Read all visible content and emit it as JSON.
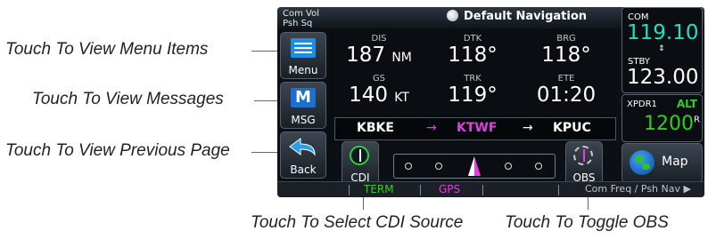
{
  "callouts": {
    "menu": "Touch To View Menu Items",
    "messages": "Touch To View Messages",
    "previous": "Touch To View Previous Page",
    "cdi_source": "Touch To Select CDI Source",
    "obs": "Touch To Toggle OBS"
  },
  "screen": {
    "top_left": [
      "Com Vol",
      "Psh Sq"
    ],
    "title": "Default Navigation",
    "buttons": {
      "menu": "Menu",
      "msg": "MSG",
      "back": "Back",
      "cdi": "CDI",
      "obs": "OBS",
      "map": "Map"
    },
    "fields": {
      "dis": {
        "label": "DIS",
        "value": "187",
        "unit": "NM"
      },
      "dtk": {
        "label": "DTK",
        "value": "118°"
      },
      "brg": {
        "label": "BRG",
        "value": "118°"
      },
      "gs": {
        "label": "GS",
        "value": "140",
        "unit": "KT"
      },
      "trk": {
        "label": "TRK",
        "value": "119°"
      },
      "ete": {
        "label": "ETE",
        "value": "01:20"
      }
    },
    "route": {
      "from": "KBKE",
      "arrow1": "→",
      "active": "KTWF",
      "arrow2": "→",
      "to": "KPUC"
    },
    "com": {
      "label": "COM",
      "active": "119.10",
      "stby_label": "STBY",
      "stby": "123.00"
    },
    "xpdr": {
      "label": "XPDR1",
      "mode": "ALT",
      "code": "1200",
      "suffix": "R"
    },
    "bottom": {
      "term": "TERM",
      "gps": "GPS",
      "hint": "Com Freq / Psh Nav ▶"
    },
    "colors": {
      "com_active": "#20e0c0",
      "accent_magenta": "#e040e0",
      "green": "#30d020"
    }
  }
}
